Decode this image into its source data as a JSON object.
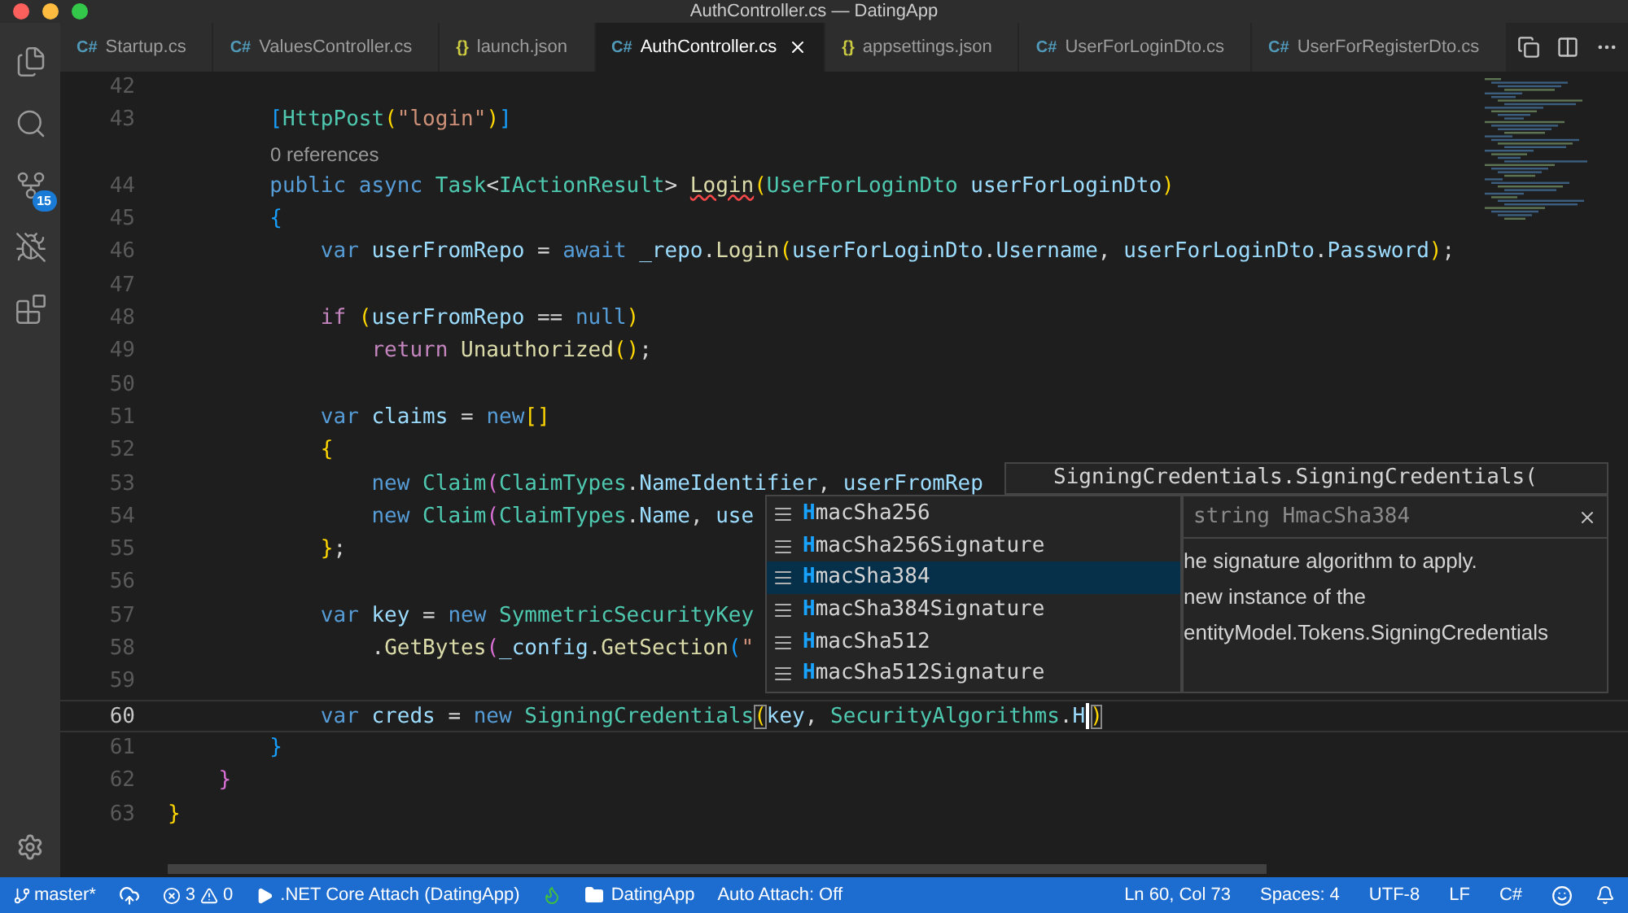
{
  "window": {
    "title": "AuthController.cs — DatingApp"
  },
  "activity_bar": {
    "items": [
      {
        "kind": "files"
      },
      {
        "kind": "search"
      },
      {
        "kind": "scm",
        "badge": "15"
      },
      {
        "kind": "debug"
      },
      {
        "kind": "extensions"
      }
    ]
  },
  "tabs": [
    {
      "kind": "csharp",
      "icon": "C#",
      "label": "Startup.cs",
      "selected": false
    },
    {
      "kind": "csharp",
      "icon": "C#",
      "label": "ValuesController.cs",
      "selected": false
    },
    {
      "kind": "json",
      "icon": "{}",
      "label": "launch.json",
      "selected": false
    },
    {
      "kind": "csharp",
      "icon": "C#",
      "label": "AuthController.cs",
      "selected": true
    },
    {
      "kind": "json",
      "icon": "{}",
      "label": "appsettings.json",
      "selected": false
    },
    {
      "kind": "csharp",
      "icon": "C#",
      "label": "UserForLoginDto.cs",
      "selected": false
    },
    {
      "kind": "csharp",
      "icon": "C#",
      "label": "UserForRegisterDto.cs",
      "selected": false
    }
  ],
  "editor": {
    "lines": [
      {
        "kind": "code",
        "number": "42",
        "current": false
      },
      {
        "kind": "code",
        "number": "43",
        "current": false,
        "tokens": [
          {
            "t": "        [",
            "kind": "blue"
          },
          {
            "t": "HttpPost",
            "kind": "type"
          },
          {
            "t": "(",
            "kind": "gold"
          },
          {
            "t": "\"login\"",
            "kind": "str"
          },
          {
            "t": ")",
            "kind": "gold"
          },
          {
            "t": "]",
            "kind": "blue"
          }
        ]
      },
      {
        "kind": "codelens",
        "text": "0 references"
      },
      {
        "kind": "code",
        "number": "44",
        "current": false,
        "tokens": [
          {
            "t": "        public async ",
            "kind": "kw"
          },
          {
            "t": "Task",
            "kind": "type"
          },
          {
            "t": "<",
            "kind": "plain"
          },
          {
            "t": "IActionResult",
            "kind": "type"
          },
          {
            "t": "> ",
            "kind": "plain"
          },
          {
            "t": "Login",
            "kind": "error"
          },
          {
            "t": "(",
            "kind": "gold"
          },
          {
            "t": "UserForLoginDto",
            "kind": "type"
          },
          {
            "t": " userForLoginDto",
            "kind": "var"
          },
          {
            "t": ")",
            "kind": "gold"
          }
        ]
      },
      {
        "kind": "code",
        "number": "45",
        "current": false,
        "tokens": [
          {
            "t": "        {",
            "kind": "blue"
          }
        ]
      },
      {
        "kind": "code",
        "number": "46",
        "current": false,
        "tokens": [
          {
            "t": "            var ",
            "kind": "kw"
          },
          {
            "t": "userFromRepo",
            "kind": "var"
          },
          {
            "t": " = ",
            "kind": "plain"
          },
          {
            "t": "await ",
            "kind": "kw"
          },
          {
            "t": "_repo",
            "kind": "var"
          },
          {
            "t": ".",
            "kind": "plain"
          },
          {
            "t": "Login",
            "kind": "fn"
          },
          {
            "t": "(",
            "kind": "gold"
          },
          {
            "t": "userForLoginDto",
            "kind": "var"
          },
          {
            "t": ".",
            "kind": "plain"
          },
          {
            "t": "Username",
            "kind": "var"
          },
          {
            "t": ", ",
            "kind": "plain"
          },
          {
            "t": "userForLoginDto",
            "kind": "var"
          },
          {
            "t": ".",
            "kind": "plain"
          },
          {
            "t": "Password",
            "kind": "var"
          },
          {
            "t": ")",
            "kind": "gold"
          },
          {
            "t": ";",
            "kind": "plain"
          }
        ]
      },
      {
        "kind": "code",
        "number": "47",
        "current": false
      },
      {
        "kind": "code",
        "number": "48",
        "current": false,
        "tokens": [
          {
            "t": "            if ",
            "kind": "ctl"
          },
          {
            "t": "(",
            "kind": "gold"
          },
          {
            "t": "userFromRepo",
            "kind": "var"
          },
          {
            "t": " == ",
            "kind": "plain"
          },
          {
            "t": "null",
            "kind": "kw"
          },
          {
            "t": ")",
            "kind": "gold"
          }
        ]
      },
      {
        "kind": "code",
        "number": "49",
        "current": false,
        "tokens": [
          {
            "t": "                return ",
            "kind": "ctl"
          },
          {
            "t": "Unauthorized",
            "kind": "fn"
          },
          {
            "t": "()",
            "kind": "gold"
          },
          {
            "t": ";",
            "kind": "plain"
          }
        ]
      },
      {
        "kind": "code",
        "number": "50",
        "current": false
      },
      {
        "kind": "code",
        "number": "51",
        "current": false,
        "tokens": [
          {
            "t": "            var ",
            "kind": "kw"
          },
          {
            "t": "claims",
            "kind": "var"
          },
          {
            "t": " = ",
            "kind": "plain"
          },
          {
            "t": "new",
            "kind": "kw"
          },
          {
            "t": "[]",
            "kind": "gold"
          }
        ]
      },
      {
        "kind": "code",
        "number": "52",
        "current": false,
        "tokens": [
          {
            "t": "            {",
            "kind": "gold"
          }
        ]
      },
      {
        "kind": "code",
        "number": "53",
        "current": false,
        "tokens": [
          {
            "t": "                new ",
            "kind": "kw"
          },
          {
            "t": "Claim",
            "kind": "type"
          },
          {
            "t": "(",
            "kind": "orchid"
          },
          {
            "t": "ClaimTypes",
            "kind": "type"
          },
          {
            "t": ".",
            "kind": "plain"
          },
          {
            "t": "NameIdentifier",
            "kind": "var"
          },
          {
            "t": ", ",
            "kind": "plain"
          },
          {
            "t": "userFromRep",
            "kind": "var"
          }
        ]
      },
      {
        "kind": "code",
        "number": "54",
        "current": false,
        "tokens": [
          {
            "t": "                new ",
            "kind": "kw"
          },
          {
            "t": "Claim",
            "kind": "type"
          },
          {
            "t": "(",
            "kind": "orchid"
          },
          {
            "t": "ClaimTypes",
            "kind": "type"
          },
          {
            "t": ".",
            "kind": "plain"
          },
          {
            "t": "Name",
            "kind": "var"
          },
          {
            "t": ", ",
            "kind": "plain"
          },
          {
            "t": "use",
            "kind": "var"
          }
        ]
      },
      {
        "kind": "code",
        "number": "55",
        "current": false,
        "tokens": [
          {
            "t": "            }",
            "kind": "gold"
          },
          {
            "t": ";",
            "kind": "plain"
          }
        ]
      },
      {
        "kind": "code",
        "number": "56",
        "current": false
      },
      {
        "kind": "code",
        "number": "57",
        "current": false,
        "tokens": [
          {
            "t": "            var ",
            "kind": "kw"
          },
          {
            "t": "key",
            "kind": "var"
          },
          {
            "t": " = ",
            "kind": "plain"
          },
          {
            "t": "new ",
            "kind": "kw"
          },
          {
            "t": "SymmetricSecurityKey",
            "kind": "type"
          }
        ]
      },
      {
        "kind": "code",
        "number": "58",
        "current": false,
        "tokens": [
          {
            "t": "                .",
            "kind": "plain"
          },
          {
            "t": "GetBytes",
            "kind": "fn"
          },
          {
            "t": "(",
            "kind": "orchid"
          },
          {
            "t": "_config",
            "kind": "var"
          },
          {
            "t": ".",
            "kind": "plain"
          },
          {
            "t": "GetSection",
            "kind": "fn"
          },
          {
            "t": "(",
            "kind": "blue"
          },
          {
            "t": "\"",
            "kind": "str"
          }
        ]
      },
      {
        "kind": "code",
        "number": "59",
        "current": false
      },
      {
        "kind": "code",
        "number": "60",
        "current": true,
        "tokens": [
          {
            "t": "            var ",
            "kind": "kw"
          },
          {
            "t": "creds",
            "kind": "var"
          },
          {
            "t": " = ",
            "kind": "plain"
          },
          {
            "t": "new ",
            "kind": "kw"
          },
          {
            "t": "SigningCredentials",
            "kind": "type"
          },
          {
            "t": "(",
            "kind": "match"
          },
          {
            "t": "key",
            "kind": "var"
          },
          {
            "t": ", ",
            "kind": "plain"
          },
          {
            "t": "SecurityAlgorithms",
            "kind": "type"
          },
          {
            "t": ".",
            "kind": "plain"
          },
          {
            "t": "H",
            "kind": "var"
          },
          {
            "t": ")",
            "kind": "match"
          }
        ]
      },
      {
        "kind": "code",
        "number": "61",
        "current": false,
        "tokens": [
          {
            "t": "        }",
            "kind": "blue"
          }
        ]
      },
      {
        "kind": "code",
        "number": "62",
        "current": false,
        "tokens": [
          {
            "t": "    }",
            "kind": "orchid"
          }
        ]
      },
      {
        "kind": "code",
        "number": "63",
        "current": false,
        "tokens": [
          {
            "t": "}",
            "kind": "gold"
          }
        ]
      }
    ]
  },
  "signature_help": {
    "text": "SigningCredentials.SigningCredentials("
  },
  "suggestions": {
    "items": [
      {
        "match": "H",
        "rest": "macSha256",
        "selected": false
      },
      {
        "match": "H",
        "rest": "macSha256Signature",
        "selected": false
      },
      {
        "match": "H",
        "rest": "macSha384",
        "selected": true
      },
      {
        "match": "H",
        "rest": "macSha384Signature",
        "selected": false
      },
      {
        "match": "H",
        "rest": "macSha512",
        "selected": false
      },
      {
        "match": "H",
        "rest": "macSha512Signature",
        "selected": false
      }
    ]
  },
  "details": {
    "title": "string HmacSha384",
    "lines": [
      "he signature algorithm to apply.",
      "new instance of the",
      "entityModel.Tokens.SigningCredentials"
    ]
  },
  "status_bar": {
    "branch": "master*",
    "errors": "3",
    "warnings": "0",
    "debug": ".NET Core Attach (DatingApp)",
    "folder": "DatingApp",
    "auto_attach": "Auto Attach: Off",
    "right": [
      "Ln 60, Col 73",
      "Spaces: 4",
      "UTF-8",
      "LF",
      "C#"
    ]
  }
}
